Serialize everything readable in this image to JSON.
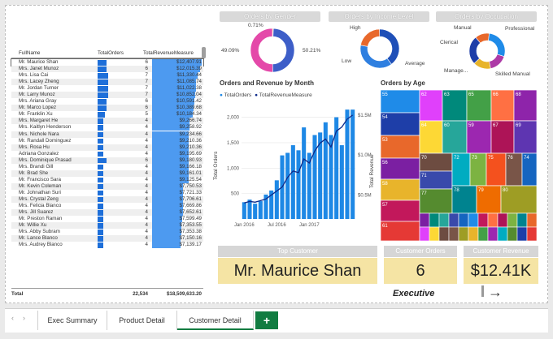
{
  "table": {
    "headers": {
      "name": "FullName",
      "orders": "TotalOrders",
      "revenue": "TotalRevenueMeasure"
    },
    "rows": [
      {
        "name": "Mr. Maurice Shan",
        "orders": "6",
        "revenue": "$12,407.91",
        "o": 6,
        "r": 12407.91
      },
      {
        "name": "Mrs. Janet Munoz",
        "orders": "6",
        "revenue": "$12,015.39",
        "o": 6,
        "r": 12015.39
      },
      {
        "name": "Mrs. Lisa Cai",
        "orders": "7",
        "revenue": "$11,330.44",
        "o": 7,
        "r": 11330.44
      },
      {
        "name": "Mrs. Lacey Zheng",
        "orders": "7",
        "revenue": "$11,085.74",
        "o": 7,
        "r": 11085.74
      },
      {
        "name": "Mr. Jordan Turner",
        "orders": "7",
        "revenue": "$11,022.38",
        "o": 7,
        "r": 11022.38
      },
      {
        "name": "Mr. Larry Munoz",
        "orders": "7",
        "revenue": "$10,852.04",
        "o": 7,
        "r": 10852.04
      },
      {
        "name": "Mrs. Ariana Gray",
        "orders": "6",
        "revenue": "$10,591.42",
        "o": 6,
        "r": 10591.42
      },
      {
        "name": "Mr. Marco Lopez",
        "orders": "6",
        "revenue": "$10,389.68",
        "o": 6,
        "r": 10389.68
      },
      {
        "name": "Mr. Franklin Xu",
        "orders": "5",
        "revenue": "$10,184.34",
        "o": 5,
        "r": 10184.34
      },
      {
        "name": "Mrs. Margaret He",
        "orders": "4",
        "revenue": "$9,266.74",
        "o": 4,
        "r": 9266.74
      },
      {
        "name": "Mrs. Kaitlyn Henderson",
        "orders": "4",
        "revenue": "$9,258.92",
        "o": 4,
        "r": 9258.92
      },
      {
        "name": "Mrs. Nichole Nara",
        "orders": "4",
        "revenue": "$9,234.66",
        "o": 4,
        "r": 9234.66
      },
      {
        "name": "Mr. Randall Dominguez",
        "orders": "4",
        "revenue": "$9,210.36",
        "o": 4,
        "r": 9210.36
      },
      {
        "name": "Mrs. Rosa Hu",
        "orders": "4",
        "revenue": "$9,210.36",
        "o": 4,
        "r": 9210.36
      },
      {
        "name": "Adriana Gonzalez",
        "orders": "4",
        "revenue": "$9,195.69",
        "o": 4,
        "r": 9195.69
      },
      {
        "name": "Mrs. Dominique Prasad",
        "orders": "6",
        "revenue": "$9,180.93",
        "o": 6,
        "r": 9180.93
      },
      {
        "name": "Mrs. Brandi Gill",
        "orders": "4",
        "revenue": "$9,166.18",
        "o": 4,
        "r": 9166.18
      },
      {
        "name": "Mr. Brad She",
        "orders": "4",
        "revenue": "$9,161.01",
        "o": 4,
        "r": 9161.01
      },
      {
        "name": "Mr. Francisco Sara",
        "orders": "4",
        "revenue": "$9,125.54",
        "o": 4,
        "r": 9125.54
      },
      {
        "name": "Mr. Kevin Coleman",
        "orders": "4",
        "revenue": "$7,750.53",
        "o": 4,
        "r": 7750.53
      },
      {
        "name": "Mr. Johnathan Suri",
        "orders": "4",
        "revenue": "$7,721.33",
        "o": 4,
        "r": 7721.33
      },
      {
        "name": "Mrs. Crystal Zeng",
        "orders": "4",
        "revenue": "$7,706.61",
        "o": 4,
        "r": 7706.61
      },
      {
        "name": "Mrs. Felicia Blanco",
        "orders": "4",
        "revenue": "$7,669.86",
        "o": 4,
        "r": 7669.86
      },
      {
        "name": "Mrs. Jill Suarez",
        "orders": "4",
        "revenue": "$7,652.61",
        "o": 4,
        "r": 7652.61
      },
      {
        "name": "Mr. Preston Raman",
        "orders": "4",
        "revenue": "$7,599.49",
        "o": 4,
        "r": 7599.49
      },
      {
        "name": "Mr. Willie Xu",
        "orders": "4",
        "revenue": "$7,353.55",
        "o": 4,
        "r": 7353.55
      },
      {
        "name": "Mrs. Abby Subram",
        "orders": "4",
        "revenue": "$7,353.38",
        "o": 4,
        "r": 7353.38
      },
      {
        "name": "Mr. Lance Blanco",
        "orders": "4",
        "revenue": "$7,150.16",
        "o": 4,
        "r": 7150.16
      },
      {
        "name": "Mrs. Audrey Blanco",
        "orders": "4",
        "revenue": "$7,139.17",
        "o": 4,
        "r": 7139.17
      }
    ],
    "total_label": "Total",
    "total_orders": "22,534",
    "total_revenue": "$18,509,633.20"
  },
  "gender": {
    "title": "Orders by Gender",
    "labels": [
      "0.71%",
      "49.09%",
      "50.21%"
    ],
    "chart_data": {
      "type": "pie",
      "values": [
        0.71,
        49.09,
        50.21
      ],
      "colors": [
        "#f2994a",
        "#3d5ec8",
        "#e449a9"
      ]
    }
  },
  "income": {
    "title": "Orders by Income Level",
    "labels": [
      "High",
      "Low",
      "Average"
    ],
    "chart_data": {
      "type": "pie",
      "categories": [
        "High",
        "Low",
        "Average"
      ],
      "values": [
        22,
        40,
        38
      ],
      "colors": [
        "#e8682b",
        "#1e4fb8",
        "#2e7fe0"
      ]
    }
  },
  "occupation": {
    "title": "Orders by Occupation",
    "labels": [
      "Manual",
      "Professional",
      "Clerical",
      "Manage...",
      "Skilled Manual"
    ],
    "chart_data": {
      "type": "pie",
      "categories": [
        "Manual",
        "Professional",
        "Clerical",
        "Management",
        "Skilled Manual"
      ],
      "values": [
        13,
        28,
        17,
        16,
        26
      ],
      "colors": [
        "#e8682b",
        "#1f8be8",
        "#ad3aa6",
        "#e8b42b",
        "#1e3ea8"
      ]
    }
  },
  "monthly": {
    "title": "Orders and Revenue by Month",
    "legend_orders": "TotalOrders",
    "legend_revenue": "TotalRevenueMeasure",
    "y_left_label": "Total Orders",
    "y_right_label": "Total Revenue",
    "y_left_ticks": [
      "2,000",
      "1,500",
      "1,000",
      "500"
    ],
    "y_right_ticks": [
      "$1.5M",
      "$1.0M",
      "$0.5M"
    ],
    "x_ticks": [
      "Jan 2016",
      "Jul 2016",
      "Jan 2017"
    ],
    "chart_data": {
      "type": "bar",
      "x": [
        "2016-01",
        "2016-02",
        "2016-03",
        "2016-04",
        "2016-05",
        "2016-06",
        "2016-07",
        "2016-08",
        "2016-09",
        "2016-10",
        "2016-11",
        "2016-12",
        "2017-01",
        "2017-02",
        "2017-03",
        "2017-04",
        "2017-05",
        "2017-06",
        "2017-07",
        "2017-08",
        "2017-09"
      ],
      "series": [
        {
          "name": "TotalOrders",
          "values": [
            330,
            380,
            300,
            350,
            480,
            560,
            760,
            1250,
            1300,
            1450,
            1350,
            1800,
            1300,
            1650,
            1700,
            1900,
            1650,
            2000,
            1450,
            2150,
            2150
          ]
        },
        {
          "name": "TotalRevenueMeasure",
          "values": [
            0.4,
            0.42,
            0.41,
            0.43,
            0.45,
            0.5,
            0.55,
            0.6,
            0.72,
            0.8,
            0.78,
            0.95,
            0.9,
            1.05,
            1.15,
            1.2,
            1.1,
            1.3,
            1.35,
            1.45,
            1.5
          ]
        }
      ],
      "ylim_left": [
        0,
        2200
      ],
      "ylim_right": [
        0.2,
        1.6
      ]
    }
  },
  "age": {
    "title": "Orders by Age",
    "chart_data": {
      "type": "treemap",
      "ages": [
        "55",
        "54",
        "53",
        "56",
        "58",
        "57",
        "61",
        "62",
        "63",
        "65",
        "66",
        "68",
        "64",
        "60",
        "59",
        "67",
        "69",
        "70",
        "71",
        "72",
        "73",
        "75",
        "76",
        "74",
        "77",
        "78",
        "79",
        "80"
      ],
      "colors": [
        "#1f8be8",
        "#1e3ea8",
        "#e8682b",
        "#7b1fa2",
        "#e8b42b",
        "#c2185b",
        "#e53935",
        "#e040fb",
        "#00897b",
        "#43a047",
        "#ff7043",
        "#8e24aa",
        "#fdd835",
        "#26a69a",
        "#9c27b0",
        "#ad1457",
        "#5e35b1",
        "#6d4c41",
        "#3949ab",
        "#00acc1",
        "#7cb342",
        "#f4511e",
        "#795548",
        "#1565c0",
        "#558b2f",
        "#00838f",
        "#ef6c00",
        "#9e9d24"
      ]
    }
  },
  "cards": {
    "top_customer_title": "Top Customer",
    "top_customer_value": "Mr. Maurice Shan",
    "orders_title": "Customer Orders",
    "orders_value": "6",
    "revenue_title": "Customer Revenue",
    "revenue_value": "$12.41K",
    "executive_label": "Executive",
    "arrow": "→"
  },
  "tabs": {
    "items": [
      "Exec Summary",
      "Product Detail",
      "Customer Detail"
    ],
    "active": "Customer Detail",
    "add": "+"
  }
}
